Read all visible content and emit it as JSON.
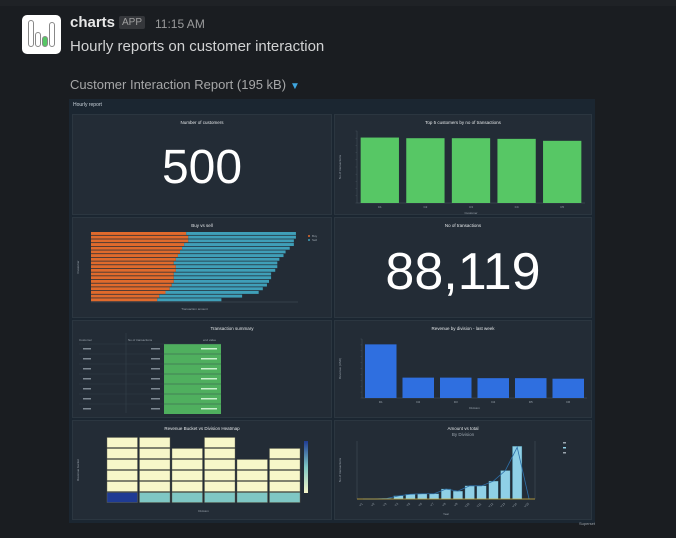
{
  "message": {
    "sender": "charts",
    "app_badge": "APP",
    "time": "11:15 AM",
    "text": "Hourly reports on customer interaction",
    "attachment": {
      "name": "Customer Interaction Report (195 kB)",
      "caret_icon": "caret-down-icon"
    }
  },
  "dashboard": {
    "title": "Hourly report",
    "footer": "Superset",
    "colors": {
      "green": "#57c765",
      "orange": "#e06a2c",
      "teal": "#3f9fb8",
      "blue": "#2f6fe0",
      "lightblue": "#8fd0e6",
      "heat_light": "#f7f7c9",
      "heat_mid": "#7fc7c4",
      "heat_dark": "#1f3b93"
    },
    "panels": {
      "customers": {
        "title": "Number of customers",
        "value": "500"
      },
      "transactions": {
        "title": "No of transactions",
        "value": "88,119"
      },
      "table": {
        "title": "Transaction summary",
        "headers": [
          "Customer",
          "No of transactions",
          "end value"
        ],
        "rows": 7
      }
    }
  },
  "chart_data": [
    {
      "type": "bar",
      "title": "Top 5 customers by no of transactions",
      "xlabel": "Customer",
      "ylabel": "No of transactions",
      "categories": [
        "C1",
        "C2",
        "C3",
        "C4",
        "C5"
      ],
      "values": [
        100,
        99,
        99,
        98,
        95
      ],
      "ylim": [
        0,
        110
      ]
    },
    {
      "type": "bar",
      "title": "Buy vs sell",
      "orientation": "horizontal",
      "xlabel": "Transaction amount",
      "ylabel": "Customer",
      "legend": "top-right",
      "series": [
        {
          "name": "Buy",
          "values": [
            46,
            47,
            47,
            45,
            44,
            43,
            42,
            41,
            40,
            41,
            41,
            40,
            40,
            40,
            39,
            38,
            36,
            33,
            32
          ]
        },
        {
          "name": "Sell",
          "values": [
            53,
            52,
            51,
            53,
            52,
            51,
            51,
            50,
            50,
            49,
            48,
            47,
            47,
            46,
            46,
            45,
            45,
            40,
            31
          ]
        }
      ],
      "xlim": [
        0,
        100
      ]
    },
    {
      "type": "bar",
      "title": "Revenue by division - last week",
      "xlabel": "Division",
      "ylabel": "Revenue (USD)",
      "categories": [
        "D1",
        "D2",
        "D3",
        "D4",
        "D5",
        "D6"
      ],
      "values": [
        100,
        38,
        38,
        37,
        37,
        36
      ],
      "ylim": [
        0,
        110
      ]
    },
    {
      "type": "heatmap",
      "title": "Revenue Bucket vs Division Heatmap",
      "xlabel": "Division",
      "ylabel": "Revenue bucket",
      "legend": "right",
      "columns": 6,
      "rows": 6,
      "heights": [
        6,
        6,
        5,
        6,
        4,
        5
      ],
      "bottom_row_levels": [
        1.0,
        0.35,
        0.35,
        0.35,
        0.35,
        0.35
      ]
    },
    {
      "type": "bar",
      "title": "Amount vs total",
      "subtitle": "By Division",
      "xlabel": "Year",
      "ylabel": "No of transactions",
      "categories": [
        "Y1",
        "Y2",
        "Y3",
        "Y4",
        "Y5",
        "Y6",
        "Y7",
        "Y8",
        "Y9",
        "Y10",
        "Y11",
        "Y12",
        "Y13",
        "Y14",
        "Y15"
      ],
      "values": [
        0,
        0,
        1,
        6,
        9,
        10,
        10,
        19,
        15,
        25,
        25,
        34,
        54,
        100,
        0
      ],
      "line_values": [
        0,
        0,
        1,
        6,
        9,
        10,
        10,
        19,
        15,
        25,
        25,
        34,
        54,
        98,
        0
      ],
      "ylim": [
        0,
        110
      ]
    }
  ]
}
